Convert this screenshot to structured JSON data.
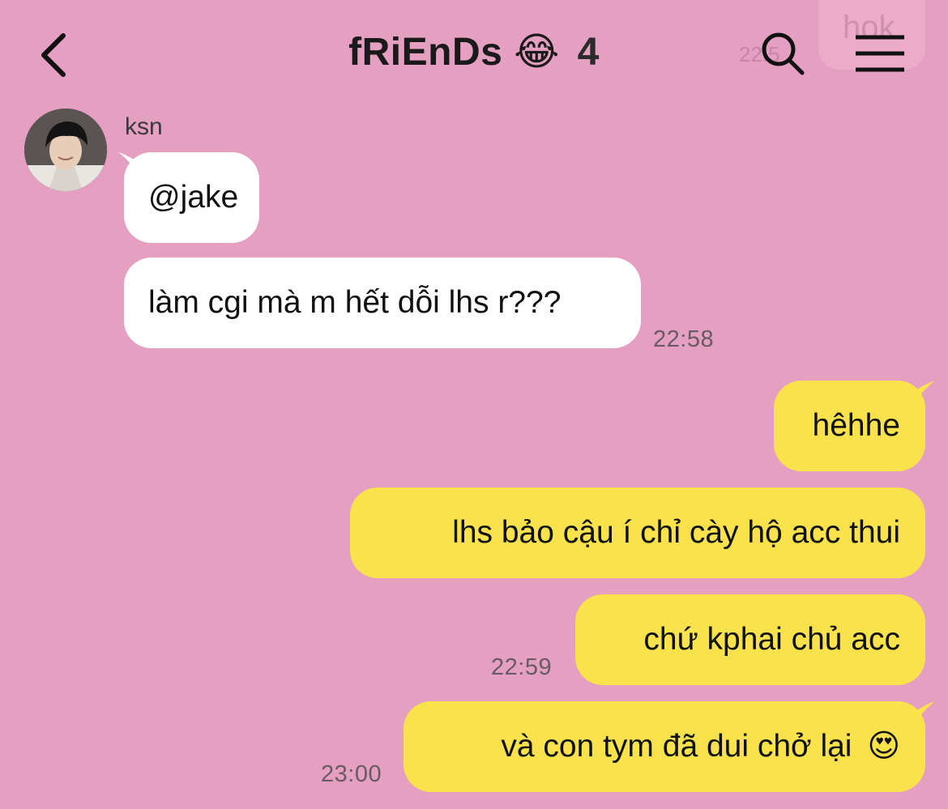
{
  "background_color": "#e59fc1",
  "header": {
    "title": "fRiEnDs",
    "emoji": "😂",
    "member_count": "4",
    "back_icon": "chevron-left-icon",
    "search_icon": "search-icon",
    "menu_icon": "menu-icon"
  },
  "ghost_overlay": {
    "text": "hok",
    "time": "22:5"
  },
  "chat": {
    "incoming_group": {
      "sender": "ksn",
      "avatar_icon": "avatar",
      "messages": [
        {
          "text": "@jake"
        },
        {
          "text": "làm cgi mà m hết dỗi lhs r???",
          "time": "22:58"
        }
      ]
    },
    "outgoing": [
      {
        "text": "hêhhe"
      },
      {
        "text": "lhs bảo cậu í chỉ cày hộ acc thui"
      },
      {
        "text": "chứ kphai chủ acc",
        "time": "22:59"
      },
      {
        "text": "và con tym đã dui chở lại",
        "emoji": "😍",
        "time": "23:00"
      }
    ]
  },
  "colors": {
    "outgoing_bubble": "#fae24c",
    "incoming_bubble": "#ffffff",
    "timestamp": "#6a5a66"
  }
}
